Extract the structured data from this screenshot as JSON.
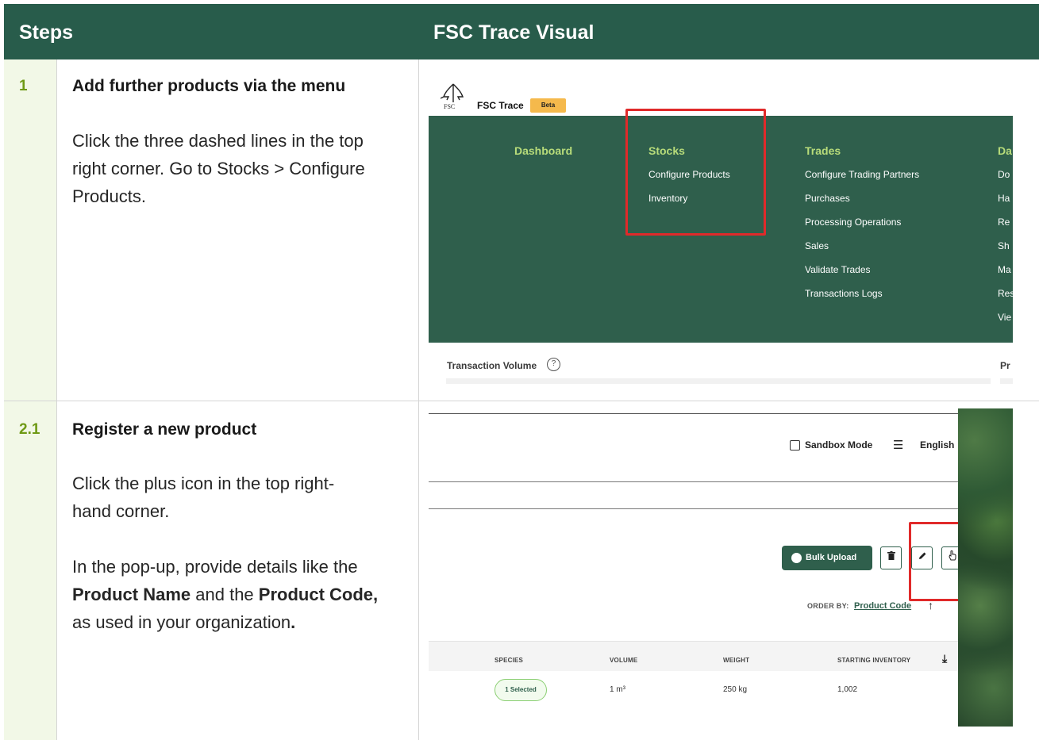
{
  "header": {
    "steps": "Steps",
    "visual": "FSC Trace Visual"
  },
  "step1": {
    "number": "1",
    "title": "Add further products via the menu",
    "lines": [
      "Click the three dashed lines in the top",
      "right corner. Go to Stocks > Configure",
      "Products."
    ]
  },
  "step2": {
    "number": "2.1",
    "title": "Register a new product",
    "lines": [
      "Click the plus icon in the top right-",
      "hand corner."
    ],
    "popup_prefix": "In the pop-up, provide details like the",
    "bold1": "Product Name",
    "and_the": " and the ",
    "bold2": "Product Code,",
    "popup_suffix": "as used in your organization",
    "period": "."
  },
  "visual1": {
    "app_name": "FSC Trace",
    "logo_text": "FSC",
    "beta": "Beta",
    "menu": {
      "dashboard": "Dashboard",
      "stocks": "Stocks",
      "stocks_items": [
        "Configure Products",
        "Inventory"
      ],
      "trades": "Trades",
      "trades_items": [
        "Configure Trading Partners",
        "Purchases",
        "Processing Operations",
        "Sales",
        "Validate Trades",
        "Transactions Logs"
      ],
      "col4": "Da",
      "col4_items": [
        "Do",
        "Ha",
        "Re",
        "Sh",
        "Ma",
        "Res",
        "Vie"
      ]
    },
    "transaction_volume": "Transaction Volume",
    "help": "?",
    "pr": "Pr"
  },
  "visual2": {
    "sandbox": "Sandbox Mode",
    "language": "English",
    "bulk_upload": "Bulk Upload",
    "order_by": "ORDER BY:",
    "order_value": "Product Code",
    "columns": [
      "SPECIES",
      "VOLUME",
      "WEIGHT",
      "STARTING INVENTORY"
    ],
    "row": {
      "species": "1 Selected",
      "volume": "1 m³",
      "weight": "250 kg",
      "inventory": "1,002"
    }
  },
  "colors": {
    "header": "#285c4b",
    "accent": "#6f9a16",
    "numcol": "#f2f8e7",
    "highlight": "#e02a2a"
  }
}
